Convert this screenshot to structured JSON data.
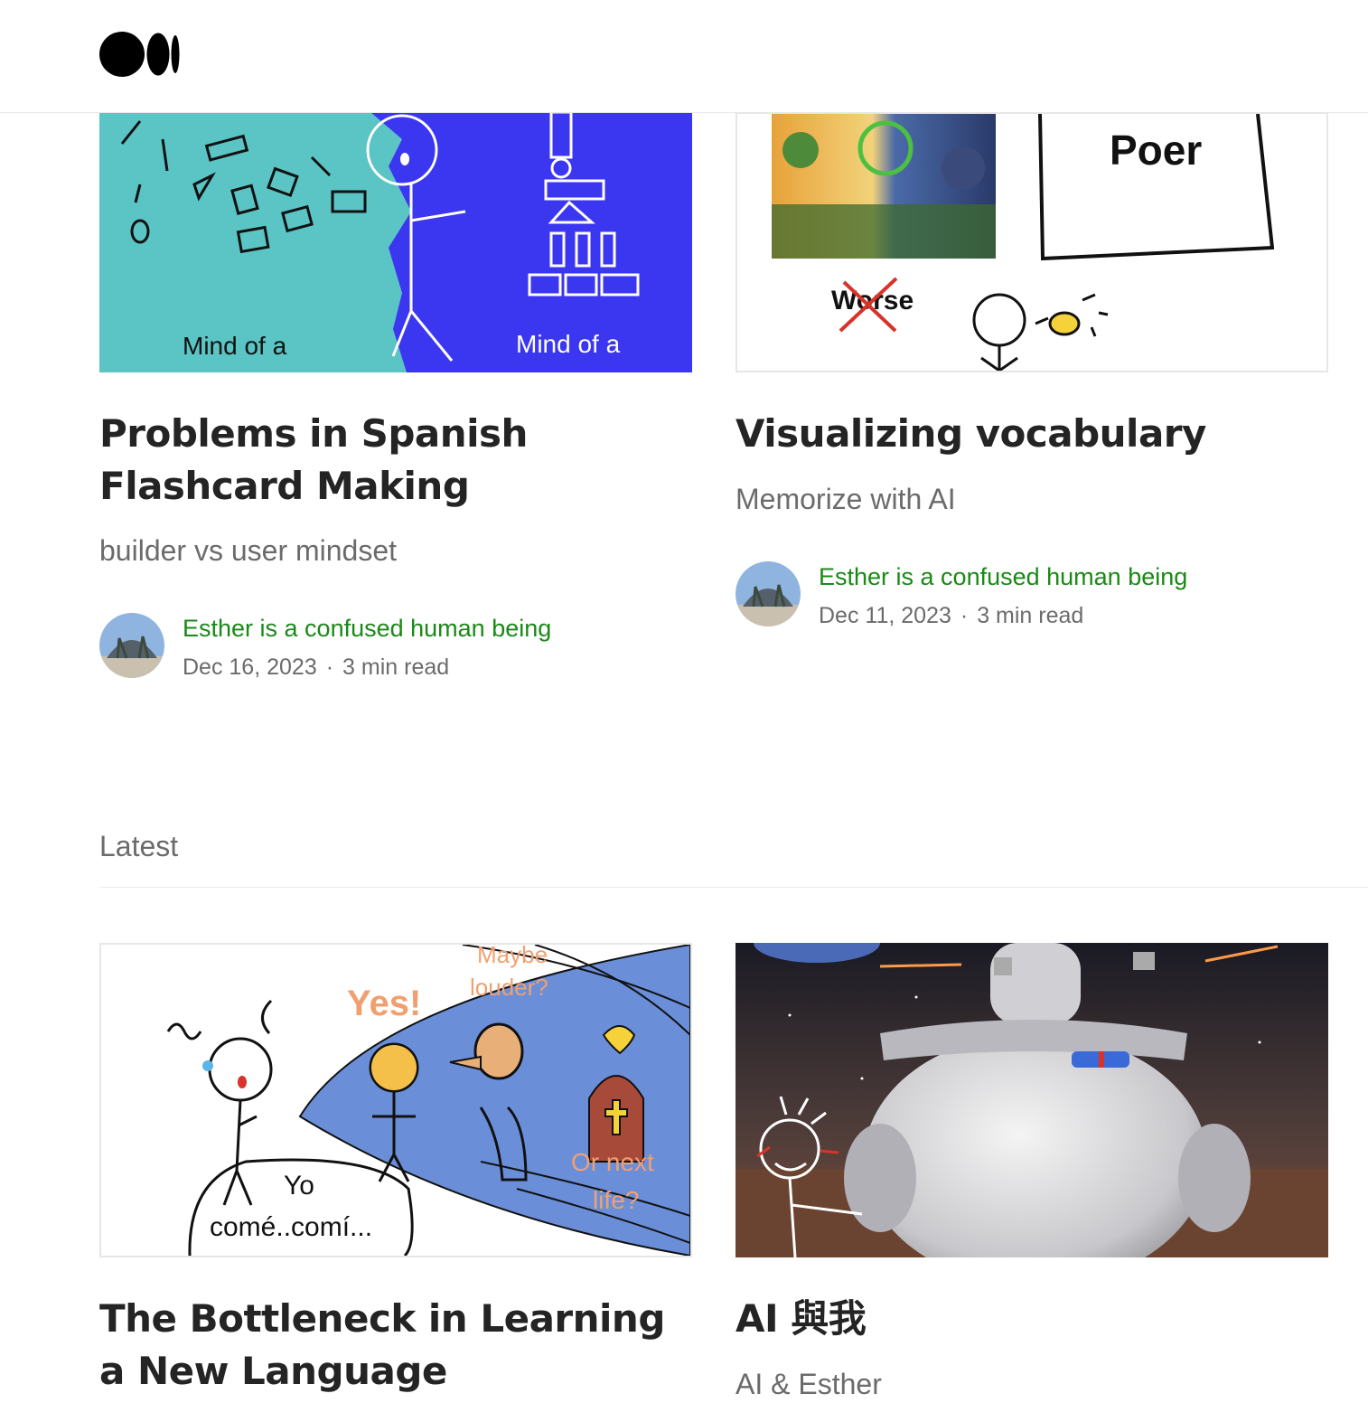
{
  "header": {
    "logo_icon": "medium-logo-icon"
  },
  "featured": [
    {
      "title": "Problems in Spanish Flashcard Making",
      "subtitle": "builder vs user mindset",
      "author": "Esther is a confused human being",
      "date": "Dec 16, 2023",
      "read_time": "3 min read",
      "thumb_text": [
        "Mind of a",
        "Mind of a"
      ]
    },
    {
      "title": "Visualizing vocabulary",
      "subtitle": "Memorize with AI",
      "author": "Esther is a confused human being",
      "date": "Dec 11, 2023",
      "read_time": "3 min read",
      "thumb_text": [
        "Poer",
        "Worse"
      ]
    }
  ],
  "latest_label": "Latest",
  "latest": [
    {
      "title": "The Bottleneck in Learning a New Language",
      "thumb_text": [
        "Yes!",
        "Maybe",
        "louder?",
        "Or next",
        "life?",
        "Yo",
        "comé..comí..."
      ]
    },
    {
      "title": "AI 與我",
      "subtitle": "AI & Esther"
    }
  ],
  "separator": "·",
  "colors": {
    "author_green": "#1a8917",
    "teal": "#5bc4c4",
    "blue": "#3b36f0",
    "cone_blue": "#6a8fd8",
    "orange": "#f0a070"
  }
}
